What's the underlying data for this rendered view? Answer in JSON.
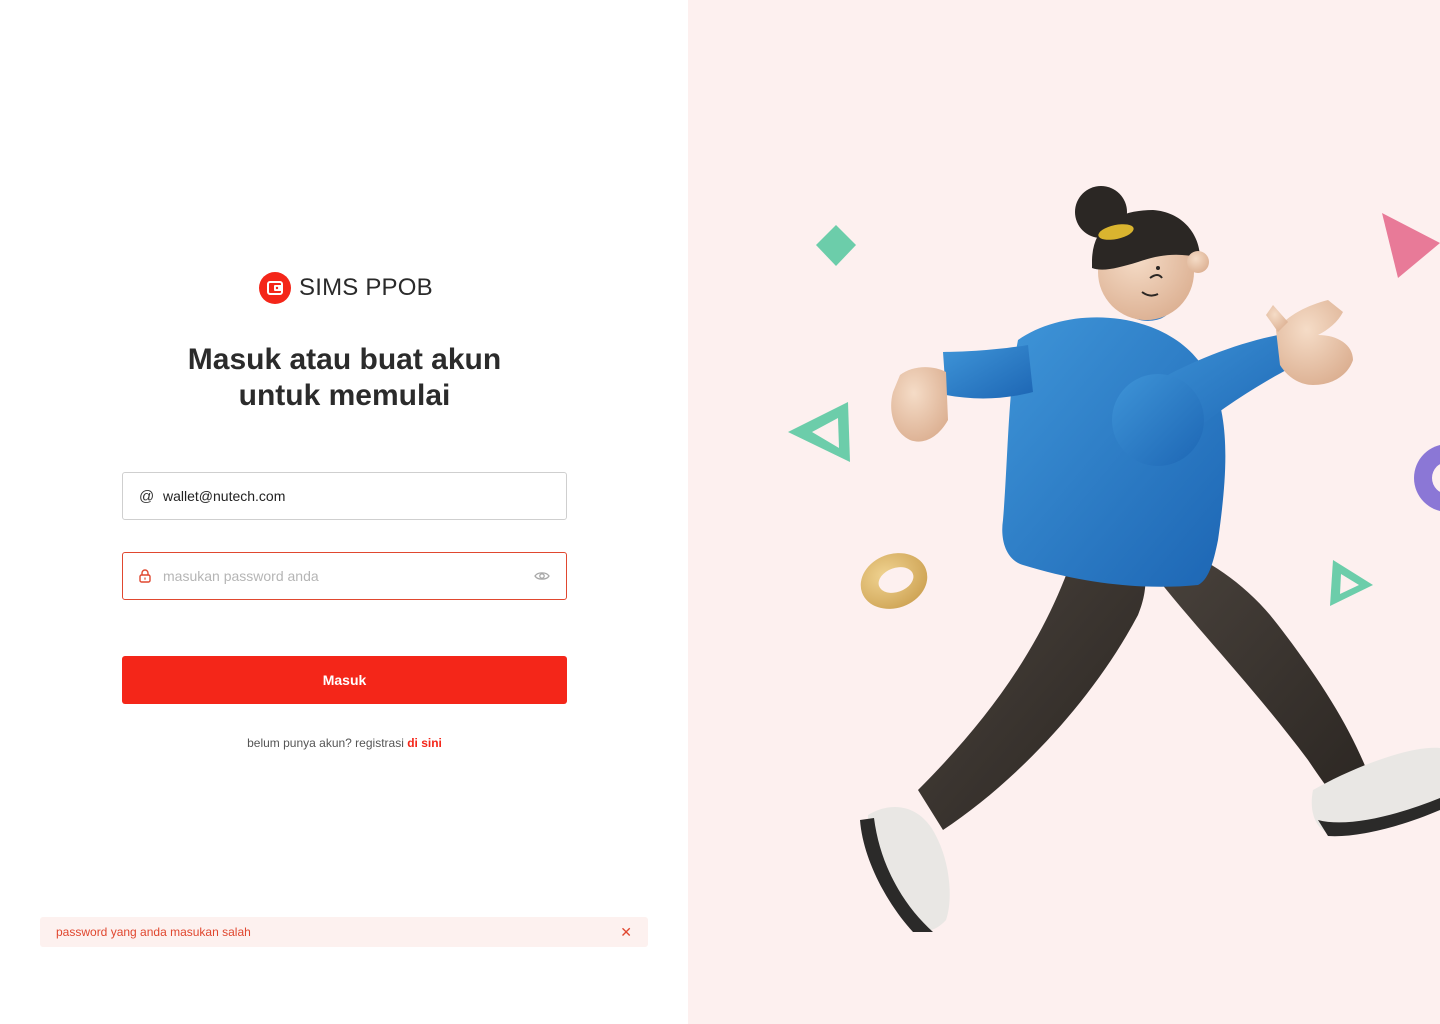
{
  "brand": {
    "name": "SIMS PPOB",
    "icon": "wallet-icon",
    "accent": "#f42619"
  },
  "headline": {
    "line1": "Masuk atau buat akun",
    "line2": "untuk memulai"
  },
  "login_form": {
    "email": {
      "icon": "at-icon",
      "value": "wallet@nutech.com",
      "placeholder": "masukan email anda"
    },
    "password": {
      "icon": "lock-icon",
      "value": "",
      "placeholder": "masukan password anda",
      "toggle_icon": "eye-icon",
      "error_color": "#e0472f"
    },
    "submit_label": "Masuk"
  },
  "register": {
    "prefix": "belum punya akun? registrasi",
    "link_label": "di sini"
  },
  "error_toast": {
    "message": "password yang anda masukan salah",
    "close_icon": "close-icon",
    "background": "#fdf1ef"
  },
  "illustration": {
    "background": "#fdf0ef",
    "subject": "walking-person-3d-illustration"
  }
}
